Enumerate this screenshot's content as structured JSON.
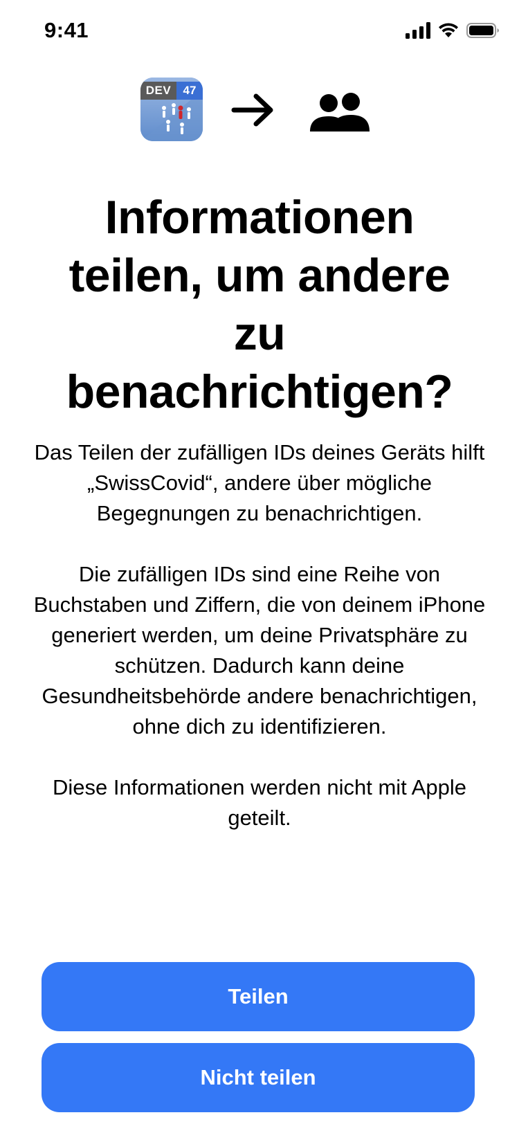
{
  "status_bar": {
    "time": "9:41",
    "icons": [
      "signal-icon",
      "wifi-icon",
      "battery-icon"
    ]
  },
  "header": {
    "app_icon": {
      "badge_label": "DEV",
      "badge_number": "47"
    },
    "arrow": "arrow-right-icon",
    "people": "people-icon"
  },
  "title": "Informationen teilen, um andere zu benachrichtigen?",
  "body": {
    "paragraph_1": "Das Teilen der zufälligen IDs deines Geräts hilft „SwissCovid“, andere über mögliche Begegnungen zu benachrichtigen.",
    "paragraph_2": "Die zufälligen IDs sind eine Reihe von Buchstaben und Ziffern, die von deinem iPhone generiert werden, um deine Privatsphäre zu schützen. Dadurch kann deine Gesundheitsbehörde andere benachrichtigen, ohne dich zu identifizieren.",
    "paragraph_3": "Diese Informationen werden nicht mit Apple geteilt."
  },
  "buttons": {
    "share_label": "Teilen",
    "dont_share_label": "Nicht teilen"
  },
  "colors": {
    "accent": "#3478f6",
    "background": "#ffffff",
    "text": "#000000"
  }
}
